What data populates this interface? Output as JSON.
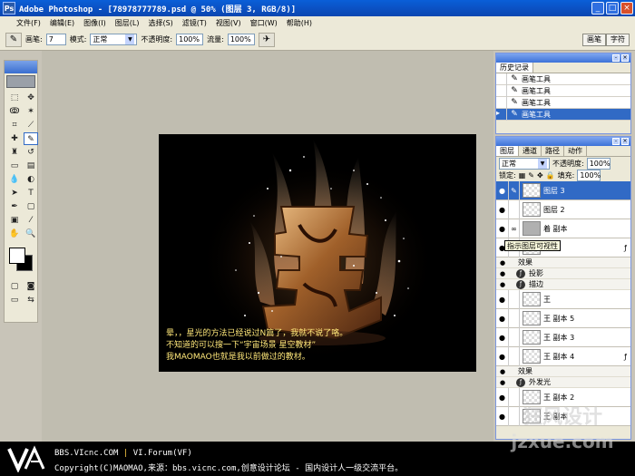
{
  "window": {
    "app_icon": "Ps",
    "title": "Adobe Photoshop - [78978777789.psd @ 50% (图层 3, RGB/8)]",
    "buttons": {
      "minimize": "_",
      "restore": "□",
      "close": "×"
    }
  },
  "menu": [
    "文件(F)",
    "编辑(E)",
    "图像(I)",
    "图层(L)",
    "选择(S)",
    "滤镜(T)",
    "视图(V)",
    "窗口(W)",
    "帮助(H)"
  ],
  "options": {
    "brush_label": "画笔:",
    "brush_size": "7",
    "mode_label": "模式:",
    "mode_value": "正常",
    "opacity_label": "不透明度:",
    "opacity_value": "100%",
    "flow_label": "流量:",
    "flow_value": "100%"
  },
  "palette_well": [
    "画笔",
    "字符"
  ],
  "history": {
    "tab": "历史记录",
    "items": [
      "画笔工具",
      "画笔工具",
      "画笔工具",
      "画笔工具"
    ]
  },
  "layers": {
    "tabs": [
      "图层",
      "通道",
      "路径",
      "动作"
    ],
    "blend_mode": "正常",
    "opacity_label": "不透明度:",
    "opacity_value": "100%",
    "lock_label": "锁定:",
    "fill_label": "填充:",
    "fill_value": "100%",
    "tooltip": "指示图层可视性",
    "rows": [
      {
        "kind": "layer",
        "name": "图层 3",
        "selected": true
      },
      {
        "kind": "layer",
        "name": "图层 2"
      },
      {
        "kind": "layer",
        "name": "着 副本",
        "dark": true
      },
      {
        "kind": "layer",
        "name": "",
        "fx": "ƒ"
      },
      {
        "kind": "effect-title",
        "name": "效果"
      },
      {
        "kind": "effect",
        "name": "投影"
      },
      {
        "kind": "effect",
        "name": "描边"
      },
      {
        "kind": "layer",
        "name": "王"
      },
      {
        "kind": "layer",
        "name": "王 副本 5"
      },
      {
        "kind": "layer",
        "name": "王 副本 3"
      },
      {
        "kind": "layer",
        "name": "王 副本 4",
        "fx": "ƒ"
      },
      {
        "kind": "effect-title",
        "name": "效果"
      },
      {
        "kind": "effect",
        "name": "外发光"
      },
      {
        "kind": "layer",
        "name": "王 副本 2"
      },
      {
        "kind": "layer",
        "name": "王 副本"
      }
    ]
  },
  "canvas": {
    "caption_lines": [
      "晕，，星光的方法已经说过N篇了，我就不说了咯。",
      "不知道的可以搜一下“宇宙场景 星空教材”",
      "我MAOMAO也就是我以前做过的教材。"
    ]
  },
  "footer": {
    "line1_site": "BBS.VIcnc.COM",
    "line1_sep": " | ",
    "line1_forum": "VI.Forum(VF)",
    "line2": "Copyright(C)MAOMAO,来源：bbs.vicnc.com,创意设计论坛 - 国内设计人一级交流平台。"
  },
  "watermark": {
    "line1": "狂风设计",
    "line2": "jzxue.com"
  }
}
